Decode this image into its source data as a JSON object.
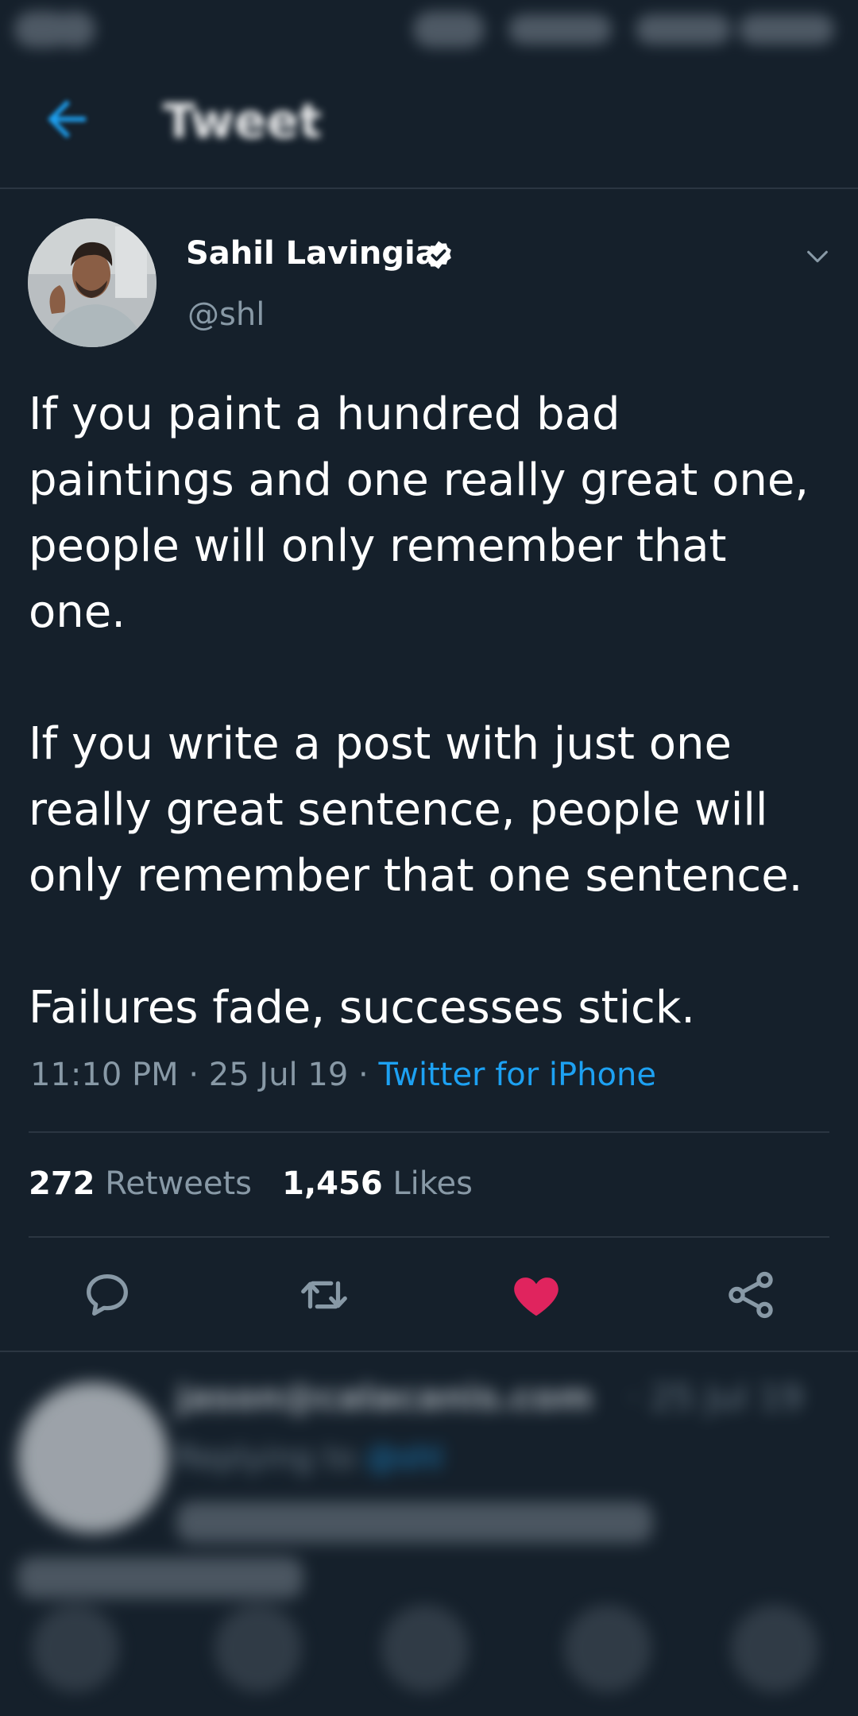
{
  "header": {
    "title": "Tweet"
  },
  "tweet": {
    "author_name": "Sahil Lavingia",
    "author_handle": "@shl",
    "paragraphs": [
      "If you paint a hundred bad\npaintings and one really great one,\npeople will only remember that\none.",
      "If you write a post with just one\nreally great sentence, people will\nonly remember that one sentence.",
      "Failures fade, successes stick."
    ],
    "time": "11:10 PM",
    "date": "25 Jul 19",
    "source": "Twitter for iPhone",
    "retweets_count": "272",
    "retweets_label": "Retweets",
    "likes_count": "1,456",
    "likes_label": "Likes",
    "liked": true,
    "colors": {
      "background": "#15202b",
      "accent": "#1da1f2",
      "like": "#e0245e",
      "secondary_text": "#8899a6"
    }
  },
  "reply": {
    "author_name": "jason@calacanis.com",
    "date": "· 25 Jul 19",
    "replying_label": "Replying to",
    "replying_handle": "@shl"
  }
}
